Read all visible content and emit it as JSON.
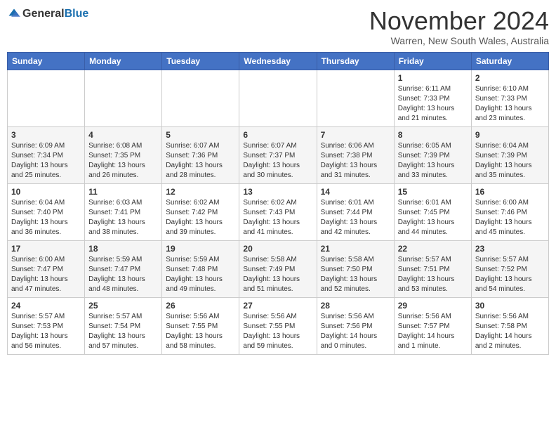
{
  "logo": {
    "general": "General",
    "blue": "Blue"
  },
  "header": {
    "month_year": "November 2024",
    "location": "Warren, New South Wales, Australia"
  },
  "weekdays": [
    "Sunday",
    "Monday",
    "Tuesday",
    "Wednesday",
    "Thursday",
    "Friday",
    "Saturday"
  ],
  "weeks": [
    [
      {
        "day": "",
        "info": ""
      },
      {
        "day": "",
        "info": ""
      },
      {
        "day": "",
        "info": ""
      },
      {
        "day": "",
        "info": ""
      },
      {
        "day": "",
        "info": ""
      },
      {
        "day": "1",
        "info": "Sunrise: 6:11 AM\nSunset: 7:33 PM\nDaylight: 13 hours\nand 21 minutes."
      },
      {
        "day": "2",
        "info": "Sunrise: 6:10 AM\nSunset: 7:33 PM\nDaylight: 13 hours\nand 23 minutes."
      }
    ],
    [
      {
        "day": "3",
        "info": "Sunrise: 6:09 AM\nSunset: 7:34 PM\nDaylight: 13 hours\nand 25 minutes."
      },
      {
        "day": "4",
        "info": "Sunrise: 6:08 AM\nSunset: 7:35 PM\nDaylight: 13 hours\nand 26 minutes."
      },
      {
        "day": "5",
        "info": "Sunrise: 6:07 AM\nSunset: 7:36 PM\nDaylight: 13 hours\nand 28 minutes."
      },
      {
        "day": "6",
        "info": "Sunrise: 6:07 AM\nSunset: 7:37 PM\nDaylight: 13 hours\nand 30 minutes."
      },
      {
        "day": "7",
        "info": "Sunrise: 6:06 AM\nSunset: 7:38 PM\nDaylight: 13 hours\nand 31 minutes."
      },
      {
        "day": "8",
        "info": "Sunrise: 6:05 AM\nSunset: 7:39 PM\nDaylight: 13 hours\nand 33 minutes."
      },
      {
        "day": "9",
        "info": "Sunrise: 6:04 AM\nSunset: 7:39 PM\nDaylight: 13 hours\nand 35 minutes."
      }
    ],
    [
      {
        "day": "10",
        "info": "Sunrise: 6:04 AM\nSunset: 7:40 PM\nDaylight: 13 hours\nand 36 minutes."
      },
      {
        "day": "11",
        "info": "Sunrise: 6:03 AM\nSunset: 7:41 PM\nDaylight: 13 hours\nand 38 minutes."
      },
      {
        "day": "12",
        "info": "Sunrise: 6:02 AM\nSunset: 7:42 PM\nDaylight: 13 hours\nand 39 minutes."
      },
      {
        "day": "13",
        "info": "Sunrise: 6:02 AM\nSunset: 7:43 PM\nDaylight: 13 hours\nand 41 minutes."
      },
      {
        "day": "14",
        "info": "Sunrise: 6:01 AM\nSunset: 7:44 PM\nDaylight: 13 hours\nand 42 minutes."
      },
      {
        "day": "15",
        "info": "Sunrise: 6:01 AM\nSunset: 7:45 PM\nDaylight: 13 hours\nand 44 minutes."
      },
      {
        "day": "16",
        "info": "Sunrise: 6:00 AM\nSunset: 7:46 PM\nDaylight: 13 hours\nand 45 minutes."
      }
    ],
    [
      {
        "day": "17",
        "info": "Sunrise: 6:00 AM\nSunset: 7:47 PM\nDaylight: 13 hours\nand 47 minutes."
      },
      {
        "day": "18",
        "info": "Sunrise: 5:59 AM\nSunset: 7:47 PM\nDaylight: 13 hours\nand 48 minutes."
      },
      {
        "day": "19",
        "info": "Sunrise: 5:59 AM\nSunset: 7:48 PM\nDaylight: 13 hours\nand 49 minutes."
      },
      {
        "day": "20",
        "info": "Sunrise: 5:58 AM\nSunset: 7:49 PM\nDaylight: 13 hours\nand 51 minutes."
      },
      {
        "day": "21",
        "info": "Sunrise: 5:58 AM\nSunset: 7:50 PM\nDaylight: 13 hours\nand 52 minutes."
      },
      {
        "day": "22",
        "info": "Sunrise: 5:57 AM\nSunset: 7:51 PM\nDaylight: 13 hours\nand 53 minutes."
      },
      {
        "day": "23",
        "info": "Sunrise: 5:57 AM\nSunset: 7:52 PM\nDaylight: 13 hours\nand 54 minutes."
      }
    ],
    [
      {
        "day": "24",
        "info": "Sunrise: 5:57 AM\nSunset: 7:53 PM\nDaylight: 13 hours\nand 56 minutes."
      },
      {
        "day": "25",
        "info": "Sunrise: 5:57 AM\nSunset: 7:54 PM\nDaylight: 13 hours\nand 57 minutes."
      },
      {
        "day": "26",
        "info": "Sunrise: 5:56 AM\nSunset: 7:55 PM\nDaylight: 13 hours\nand 58 minutes."
      },
      {
        "day": "27",
        "info": "Sunrise: 5:56 AM\nSunset: 7:55 PM\nDaylight: 13 hours\nand 59 minutes."
      },
      {
        "day": "28",
        "info": "Sunrise: 5:56 AM\nSunset: 7:56 PM\nDaylight: 14 hours\nand 0 minutes."
      },
      {
        "day": "29",
        "info": "Sunrise: 5:56 AM\nSunset: 7:57 PM\nDaylight: 14 hours\nand 1 minute."
      },
      {
        "day": "30",
        "info": "Sunrise: 5:56 AM\nSunset: 7:58 PM\nDaylight: 14 hours\nand 2 minutes."
      }
    ]
  ]
}
